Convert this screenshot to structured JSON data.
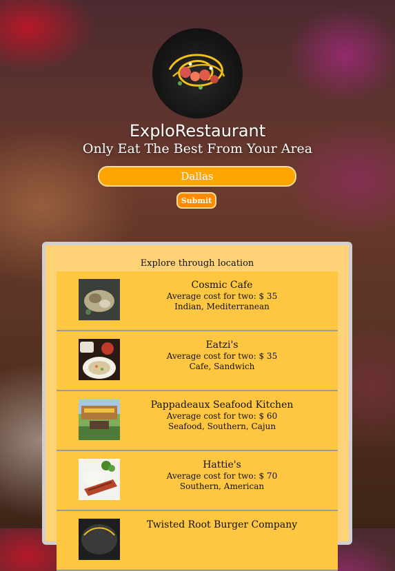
{
  "app": {
    "title": "ExploRestaurant",
    "tagline": "Only Eat The Best From Your Area"
  },
  "search": {
    "city_value": "Dallas",
    "submit_label": "Submit"
  },
  "panel": {
    "title": "Explore through location"
  },
  "restaurants": [
    {
      "name": "Cosmic Cafe",
      "cost": "Average cost for two: $ 35",
      "cuisines": "Indian, Mediterranean"
    },
    {
      "name": "Eatzi's",
      "cost": "Average cost for two: $ 35",
      "cuisines": "Cafe, Sandwich"
    },
    {
      "name": "Pappadeaux Seafood Kitchen",
      "cost": "Average cost for two: $ 60",
      "cuisines": "Seafood, Southern, Cajun"
    },
    {
      "name": "Hattie's",
      "cost": "Average cost for two: $ 70",
      "cuisines": "Southern, American"
    },
    {
      "name": "Twisted Root Burger Company",
      "cost": "",
      "cuisines": ""
    }
  ],
  "colors": {
    "accent": "#ffa500",
    "submit": "#ff8c00",
    "panel_bg": "#ffd278",
    "item_bg": "#ffc641"
  }
}
